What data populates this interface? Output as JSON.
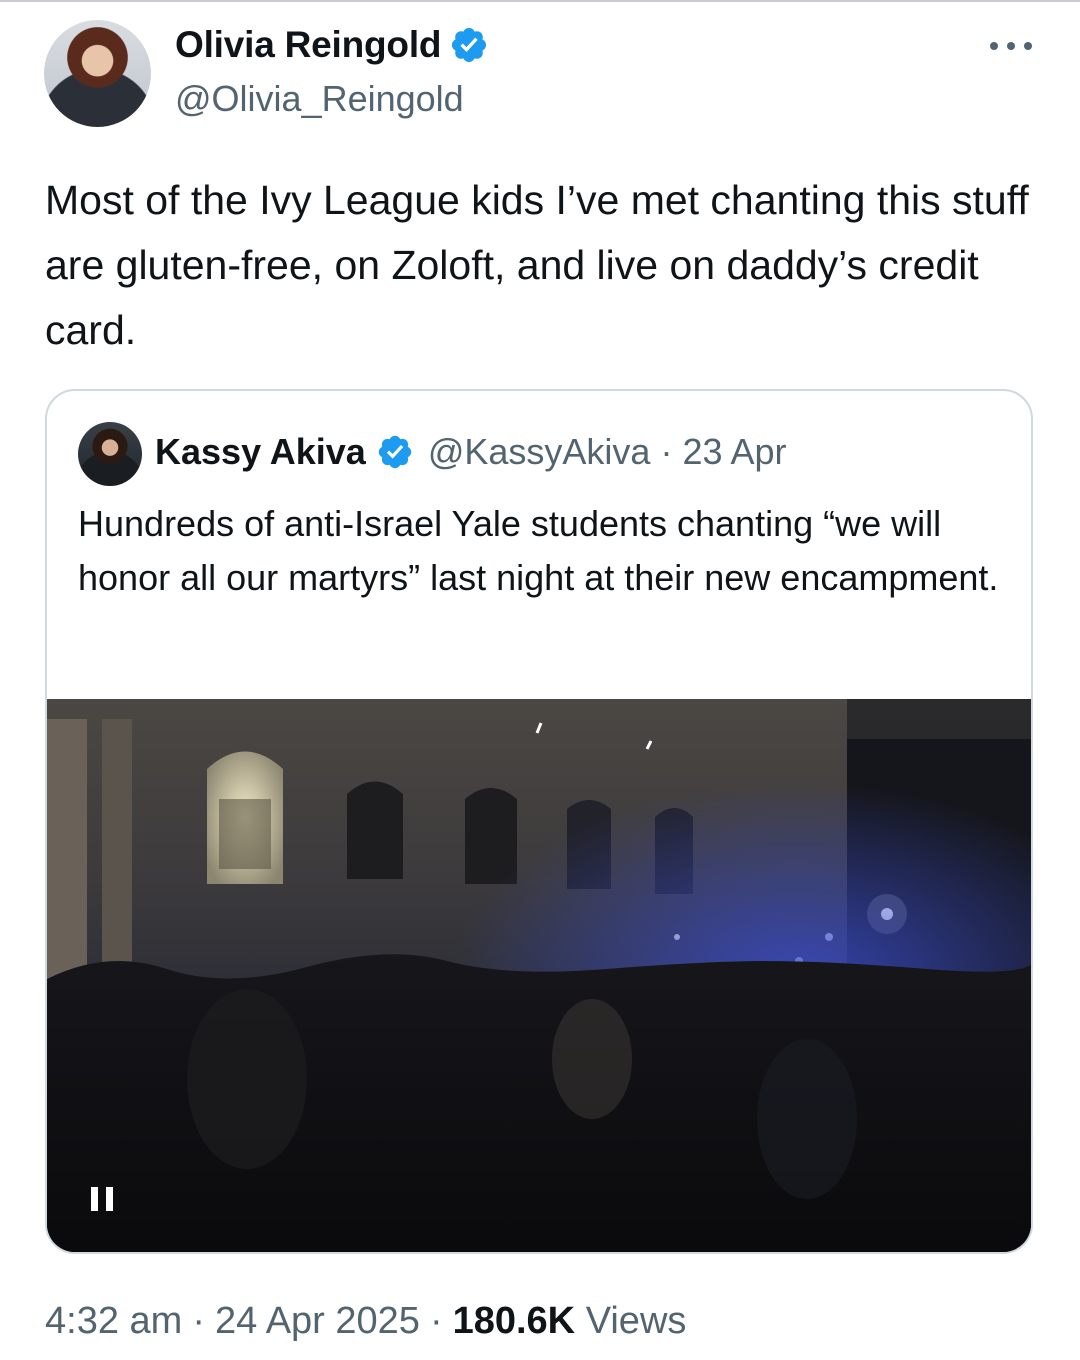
{
  "post": {
    "author_name": "Olivia Reingold",
    "author_handle": "@Olivia_Reingold",
    "text": "Most of the Ivy League kids I’ve met chanting this stuff are gluten-free, on Zoloft, and live on daddy’s credit card.",
    "time": "4:32 am",
    "date": "24 Apr 2025",
    "views_count": "180.6K",
    "views_label": "Views",
    "separator": "·"
  },
  "quote": {
    "author_name": "Kassy Akiva",
    "author_handle": "@KassyAkiva",
    "date": "23 Apr",
    "text": "Hundreds of anti-Israel Yale students chanting “we will honor all our martyrs” last night at their new encampment."
  },
  "icons": {
    "verified": "verified-badge-icon",
    "more": "more-options-icon",
    "pause": "pause-icon"
  },
  "colors": {
    "verified_blue": "#1d9bf0",
    "secondary_text": "#536471",
    "primary_text": "#0f1419"
  }
}
